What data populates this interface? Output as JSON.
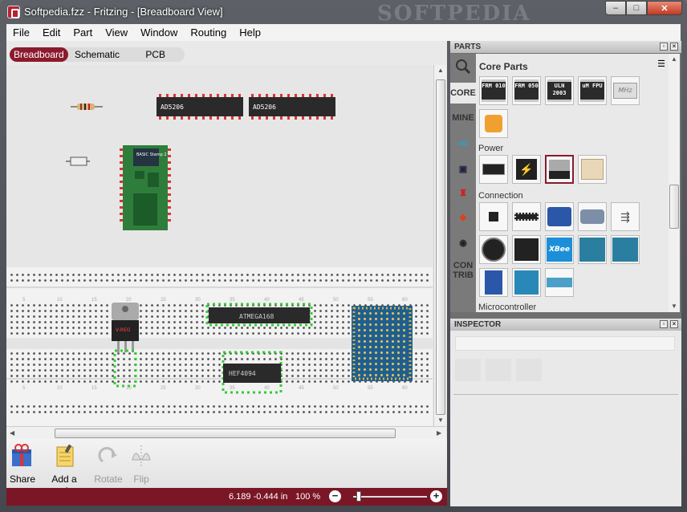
{
  "window": {
    "title": "Softpedia.fzz - Fritzing - [Breadboard View]",
    "watermark": "SOFTPEDIA",
    "controls": {
      "minimize": "–",
      "maximize": "□",
      "close": "✕"
    }
  },
  "menubar": [
    "File",
    "Edit",
    "Part",
    "View",
    "Window",
    "Routing",
    "Help"
  ],
  "view_tabs": [
    {
      "label": "Breadboard",
      "active": true
    },
    {
      "label": "Schematic",
      "active": false
    },
    {
      "label": "PCB",
      "active": false
    }
  ],
  "canvas": {
    "chips": [
      "AD5206",
      "AD5206",
      "ATMEGA168",
      "HEF4094"
    ],
    "stamp_label": "BASIC Stamp 2",
    "regulator_label": "V-REG",
    "breadboard_column_numbers": [
      "5",
      "10",
      "15",
      "20",
      "25",
      "30",
      "35",
      "40",
      "45",
      "50",
      "55",
      "60"
    ]
  },
  "toolbar": {
    "share": "Share",
    "add_note": "Add a note",
    "rotate": "Rotate",
    "flip": "Flip"
  },
  "status": {
    "coords": "6.189 -0.444 in",
    "zoom": "100 %",
    "zoom_level": 0.05
  },
  "parts_panel": {
    "header": "PARTS",
    "bin_title": "Core Parts",
    "bins": [
      "CORE",
      "MINE",
      "CON TRIB"
    ],
    "categories": [
      "Power",
      "Connection",
      "Microcontroller"
    ],
    "top_row": [
      "FRM 010",
      "FRM 050",
      "ULN 2003",
      "uM FPU",
      "MHz"
    ]
  },
  "inspector": {
    "header": "INSPECTOR"
  },
  "colors": {
    "accent": "#8b1a2c",
    "pcb_green": "#2f7d3a",
    "pcb_blue": "#1f5f8f"
  }
}
